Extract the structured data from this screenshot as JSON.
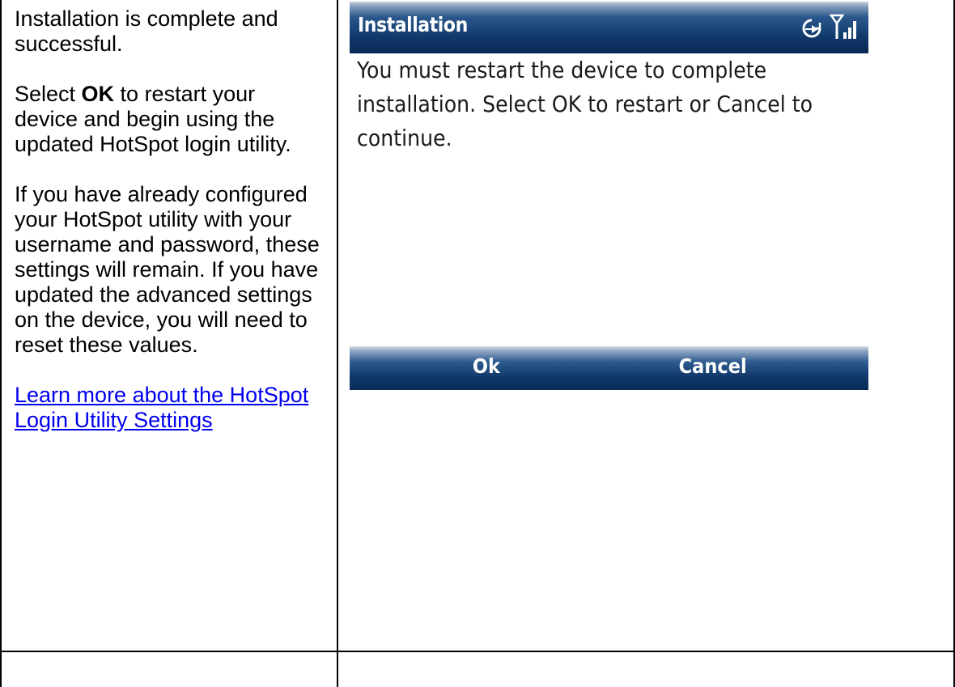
{
  "instructions": {
    "paragraph1": "Installation is complete and successful.",
    "paragraph2_prefix": "Select ",
    "paragraph2_bold": "OK",
    "paragraph2_suffix": " to restart your device and begin using the updated HotSpot login utility.",
    "paragraph3": "If you have already configured your HotSpot utility with your username and password, these settings will remain. If you have updated the advanced settings on the device, you will need to reset these values.",
    "link": "Learn more about the HotSpot Login Utility Settings"
  },
  "device": {
    "title": "Installation",
    "status_icons": [
      "sync-icon",
      "signal-strength-icon"
    ],
    "message": "You must restart the device to complete installation. Select OK to restart or Cancel to continue.",
    "softkeys": {
      "left": "Ok",
      "right": "Cancel"
    },
    "colors": {
      "title_bar": "#10386a",
      "text_on_bar": "#ffffff"
    }
  }
}
